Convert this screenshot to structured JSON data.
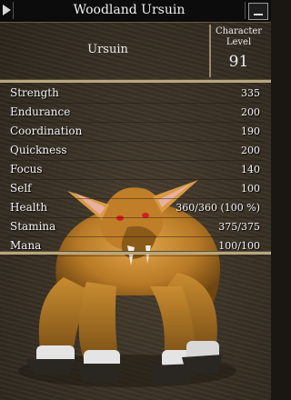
{
  "window": {
    "title": "Woodland Ursuin"
  },
  "header": {
    "race": "Ursuin",
    "level_label": "Character Level",
    "level_value": "91"
  },
  "stats": [
    {
      "name": "Strength",
      "value": "335"
    },
    {
      "name": "Endurance",
      "value": "200"
    },
    {
      "name": "Coordination",
      "value": "190"
    },
    {
      "name": "Quickness",
      "value": "200"
    },
    {
      "name": "Focus",
      "value": "140"
    },
    {
      "name": "Self",
      "value": "100"
    },
    {
      "name": "Health",
      "value": "360/360 (100 %)"
    },
    {
      "name": "Stamina",
      "value": "375/375"
    },
    {
      "name": "Mana",
      "value": "100/100"
    }
  ],
  "colors": {
    "text": "#f4f4f4",
    "titlebar": "#0c0c0c",
    "separator": "#b8a67e",
    "fur": "#c8892e"
  },
  "icons": [
    "collapse-arrow-icon",
    "minimize-icon"
  ]
}
